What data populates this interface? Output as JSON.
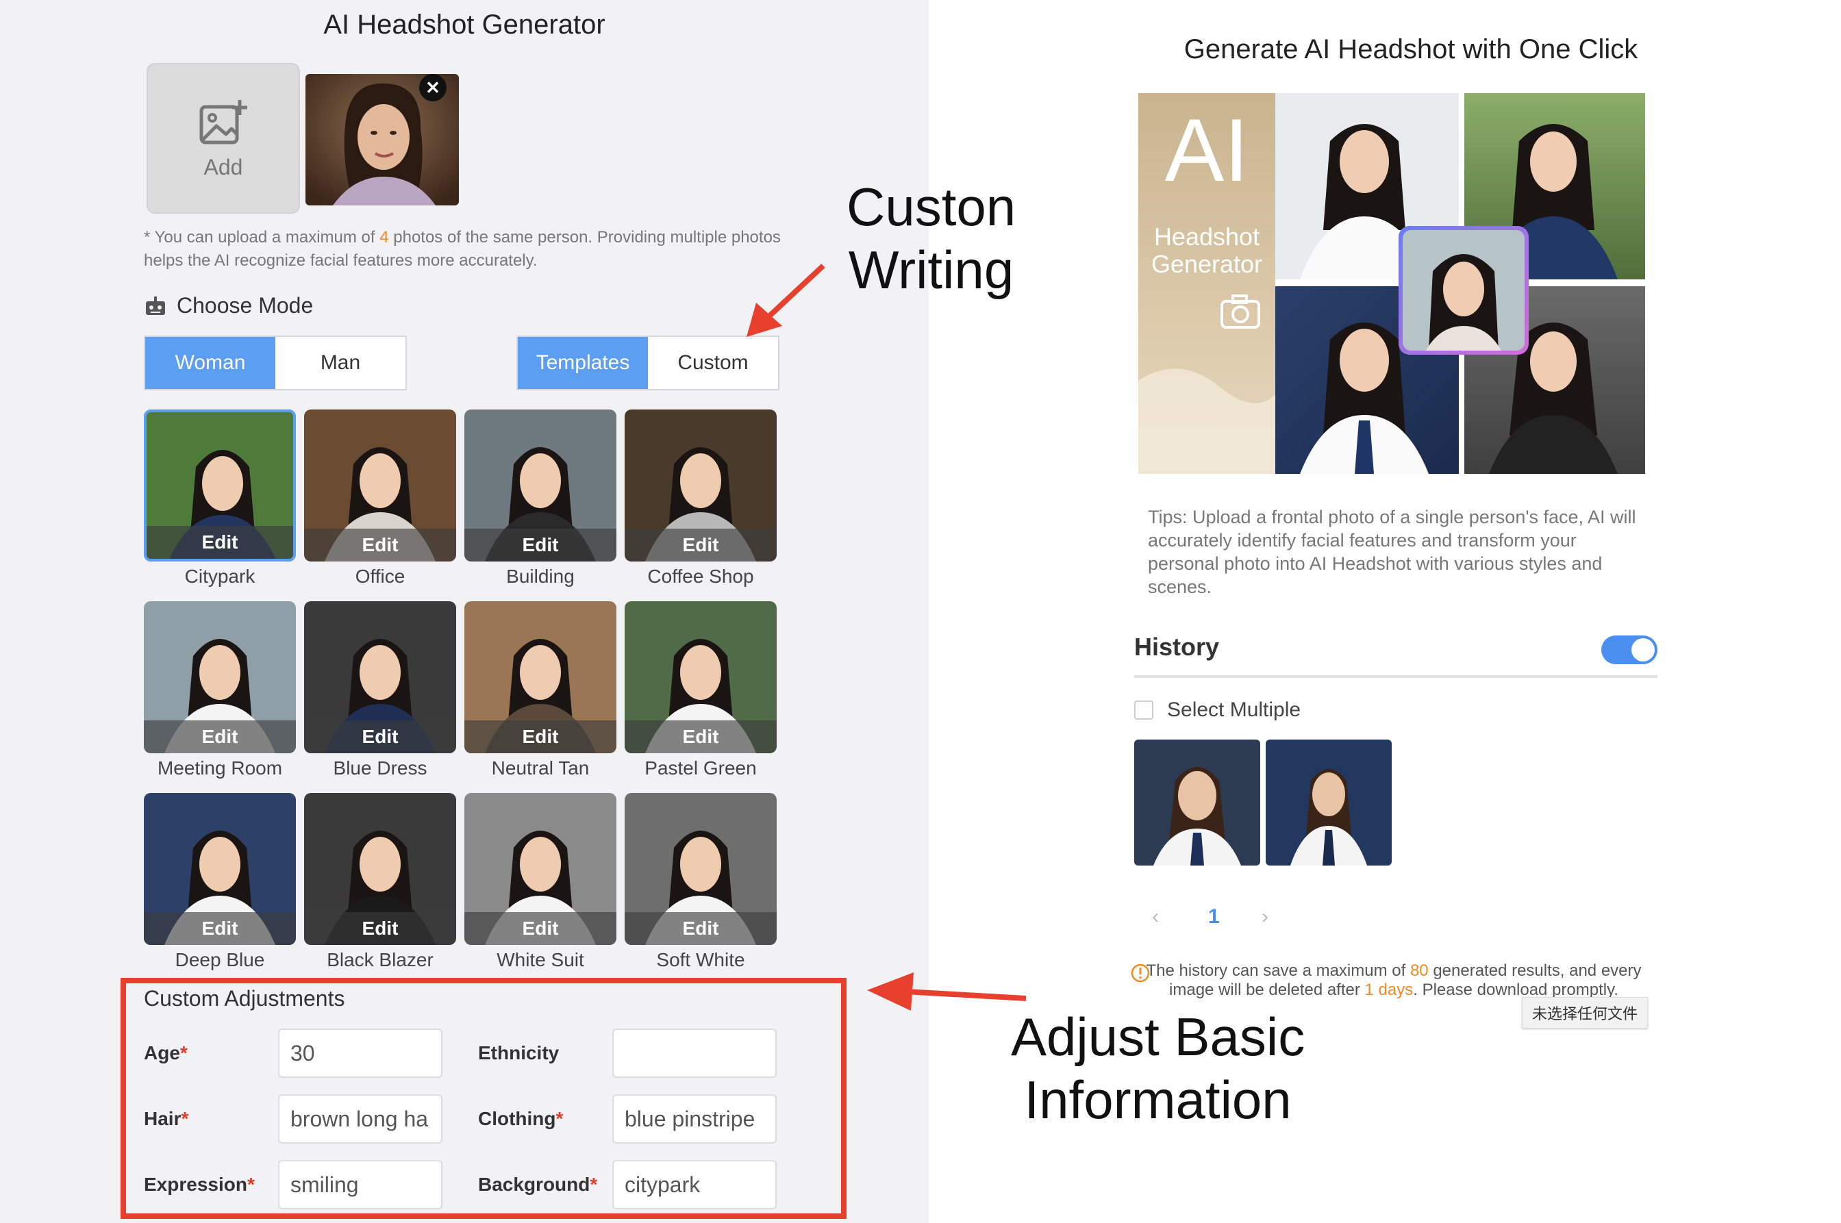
{
  "left": {
    "title": "AI Headshot Generator",
    "upload": {
      "add_label": "Add",
      "note_part1": "* You can upload a maximum of ",
      "note_max": "4",
      "note_part2": " photos of the same person. Providing multiple photos helps the AI recognize facial features more accurately."
    },
    "mode": {
      "header": "Choose Mode",
      "gender": [
        "Woman",
        "Man"
      ],
      "gender_selected": "Woman",
      "style": [
        "Templates",
        "Custom"
      ],
      "style_selected": "Templates"
    },
    "templates": {
      "edit_label": "Edit",
      "items": [
        {
          "name": "Citypark",
          "selected": true
        },
        {
          "name": "Office"
        },
        {
          "name": "Building"
        },
        {
          "name": "Coffee Shop"
        },
        {
          "name": "Meeting Room"
        },
        {
          "name": "Blue Dress"
        },
        {
          "name": "Neutral Tan"
        },
        {
          "name": "Pastel Green"
        },
        {
          "name": "Deep Blue"
        },
        {
          "name": "Black Blazer"
        },
        {
          "name": "White Suit"
        },
        {
          "name": "Soft White"
        }
      ]
    },
    "custom": {
      "title": "Custom Adjustments",
      "fields": {
        "age": {
          "label": "Age",
          "value": "30"
        },
        "ethnicity": {
          "label": "Ethnicity",
          "value": ""
        },
        "hair": {
          "label": "Hair",
          "value": "brown long ha"
        },
        "clothing": {
          "label": "Clothing",
          "value": "blue pinstripe"
        },
        "expression": {
          "label": "Expression",
          "value": "smiling"
        },
        "background": {
          "label": "Background",
          "value": "citypark"
        }
      }
    }
  },
  "annotations": {
    "custom_line1": "Custon",
    "custom_line2": "Writing",
    "adjust_line1": "Adjust Basic",
    "adjust_line2": "Information"
  },
  "right": {
    "title": "Generate AI Headshot with One Click",
    "hero": {
      "big": "AI",
      "line1": "Headshot",
      "line2": "Generator"
    },
    "tips": "Tips: Upload a frontal photo of a single person's face, AI will accurately identify facial features and transform your personal photo into AI Headshot with various styles and scenes.",
    "history": {
      "title": "History",
      "toggle_on": true,
      "select_multiple": "Select Multiple",
      "page": "1",
      "note_part1": "The history can save a maximum of ",
      "note_max": "80",
      "note_part2": " generated results, and every image will be deleted after ",
      "note_days": "1 days",
      "note_part3": ". Please download promptly.",
      "tooltip": "未选择任何文件"
    }
  },
  "colors": {
    "accent": "#5b9ef2",
    "annotation_red": "#e8402e",
    "highlight_orange": "#f08a24"
  }
}
